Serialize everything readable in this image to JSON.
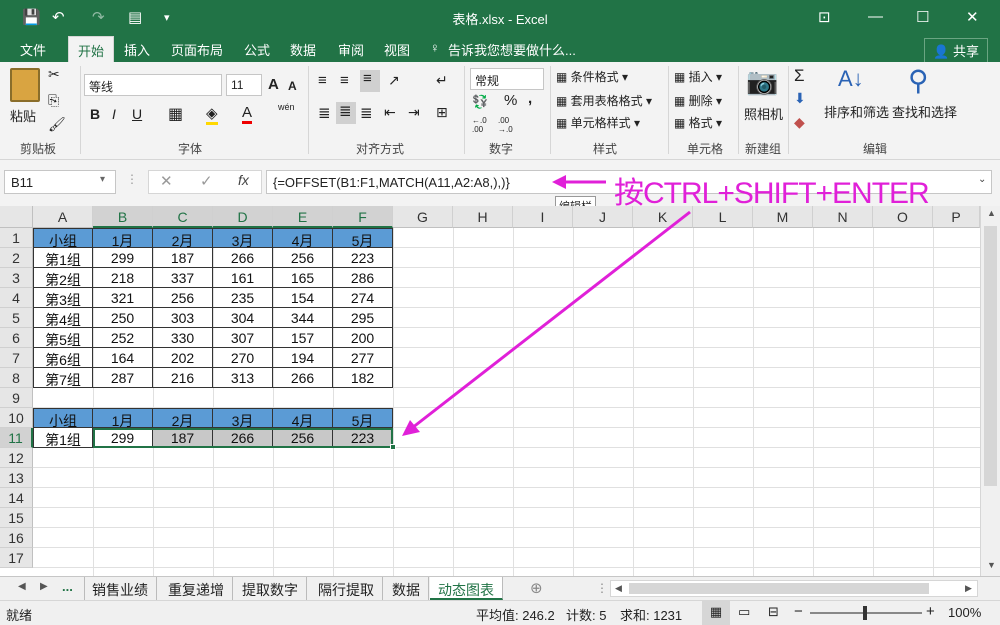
{
  "window": {
    "title": "表格.xlsx - Excel"
  },
  "tabs": [
    "文件",
    "开始",
    "插入",
    "页面布局",
    "公式",
    "数据",
    "审阅",
    "视图"
  ],
  "tell_me": "告诉我您想要做什么...",
  "share_label": "共享",
  "ribbon": {
    "paste": "粘贴",
    "clipboard_label": "剪贴板",
    "font_name": "等线",
    "font_size": "11",
    "font_group_label": "字体",
    "bold": "B",
    "italic": "I",
    "underline": "U",
    "grow_font": "A",
    "shrink_font": "A",
    "wen": "wén",
    "align_group_label": "对齐方式",
    "number_format": "常规",
    "number_group_label": "数字",
    "pct": "%",
    "comma": ",",
    "cond_format": "条件格式",
    "table_format": "套用表格格式",
    "cell_style": "单元格样式",
    "style_group_label": "样式",
    "insert": "插入",
    "delete": "删除",
    "format": "格式",
    "cells_group_label": "单元格",
    "camera": "照相机",
    "new_group_label": "新建组",
    "sigma": "Σ",
    "sort_filter": "排序和筛选",
    "find_select": "查找和选择",
    "edit_group_label": "编辑"
  },
  "formula_bar": {
    "name_box": "B11",
    "formula": "{=OFFSET(B1:F1,MATCH(A11,A2:A8,),)}",
    "tooltip": "编辑栏",
    "annotation": "按CTRL+SHIFT+ENTER"
  },
  "columns": [
    "A",
    "B",
    "C",
    "D",
    "E",
    "F",
    "G",
    "H",
    "I",
    "J",
    "K",
    "L",
    "M",
    "N",
    "O",
    "P"
  ],
  "rows": [
    "1",
    "2",
    "3",
    "4",
    "5",
    "6",
    "7",
    "8",
    "9",
    "10",
    "11",
    "12",
    "13",
    "14",
    "15",
    "16",
    "17"
  ],
  "table_header": [
    "小组",
    "1月",
    "2月",
    "3月",
    "4月",
    "5月"
  ],
  "table_rows": [
    [
      "第1组",
      "299",
      "187",
      "266",
      "256",
      "223"
    ],
    [
      "第2组",
      "218",
      "337",
      "161",
      "165",
      "286"
    ],
    [
      "第3组",
      "321",
      "256",
      "235",
      "154",
      "274"
    ],
    [
      "第4组",
      "250",
      "303",
      "304",
      "344",
      "295"
    ],
    [
      "第5组",
      "252",
      "330",
      "307",
      "157",
      "200"
    ],
    [
      "第6组",
      "164",
      "202",
      "270",
      "194",
      "277"
    ],
    [
      "第7组",
      "287",
      "216",
      "313",
      "266",
      "182"
    ]
  ],
  "lookup_header": [
    "小组",
    "1月",
    "2月",
    "3月",
    "4月",
    "5月"
  ],
  "lookup_row": [
    "第1组",
    "299",
    "187",
    "266",
    "256",
    "223"
  ],
  "sheet_tabs": [
    "销售业绩",
    "重复递增",
    "提取数字",
    "隔行提取",
    "数据",
    "动态图表"
  ],
  "active_sheet": "动态图表",
  "status": {
    "ready": "就绪",
    "average": "平均值: 246.2",
    "count": "计数: 5",
    "sum": "求和: 1231",
    "zoom": "100%"
  },
  "colors": {
    "accent": "#217346",
    "header_fill": "#5b9bd5",
    "annotation": "#e020d8"
  }
}
